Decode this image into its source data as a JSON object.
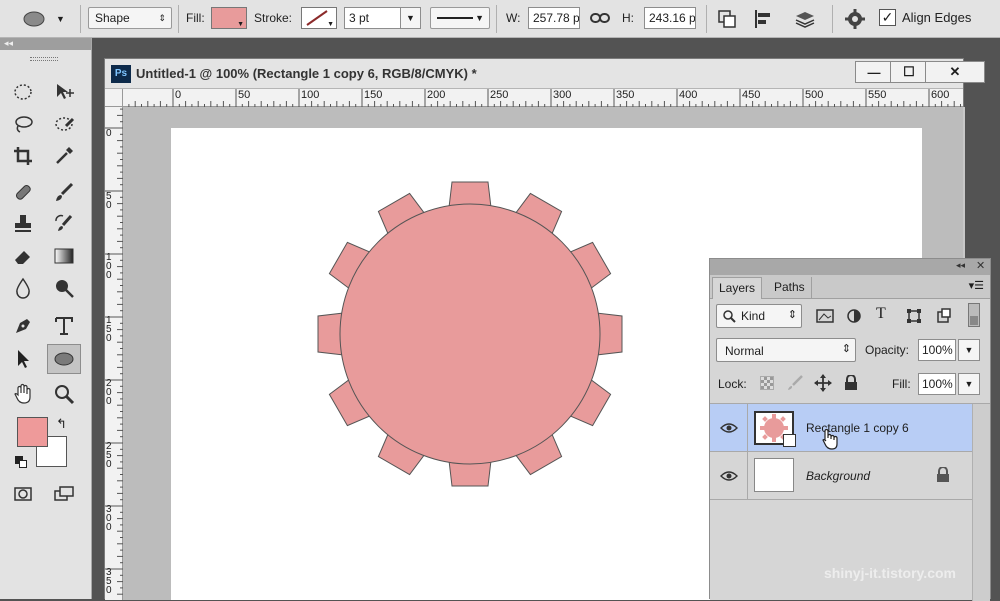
{
  "options_bar": {
    "tool_mode": "Shape",
    "fill_label": "Fill:",
    "fill_color": "#e89b9b",
    "stroke_label": "Stroke:",
    "stroke_width": "3 pt",
    "w_label": "W:",
    "w_value": "257.78 p",
    "h_label": "H:",
    "h_value": "243.16 p",
    "align_edges_label": "Align Edges",
    "align_edges_checked": true
  },
  "document": {
    "title": "Untitled-1 @ 100% (Rectangle 1 copy 6, RGB/8/CMYK) *",
    "app_badge": "Ps",
    "minimize": "—",
    "maximize": "☐",
    "close": "✕"
  },
  "rulers": {
    "h_labels": [
      "0",
      "50",
      "100",
      "150",
      "200",
      "250",
      "300",
      "350",
      "400",
      "450",
      "500",
      "550",
      "600"
    ],
    "v_labels": [
      "0",
      "5 0",
      "1 0 0",
      "1 5 0",
      "2 0 0",
      "2 5 0",
      "3 0 0",
      "3 5 0"
    ]
  },
  "shape": {
    "fill": "#e89b9b",
    "stroke": "#555555",
    "teeth_count": 12
  },
  "colors": {
    "foreground": "#ee9a9a",
    "background": "#ffffff"
  },
  "layers_panel": {
    "tabs": [
      "Layers",
      "Paths"
    ],
    "filter_kind": "Kind",
    "blend_mode": "Normal",
    "opacity_label": "Opacity:",
    "opacity_value": "100%",
    "lock_label": "Lock:",
    "fill_label": "Fill:",
    "fill_value": "100%",
    "layers": [
      {
        "name": "Rectangle 1 copy 6",
        "selected": true
      },
      {
        "name": "Background",
        "selected": false
      }
    ]
  },
  "watermark": "shinyj-it.tistory.com"
}
